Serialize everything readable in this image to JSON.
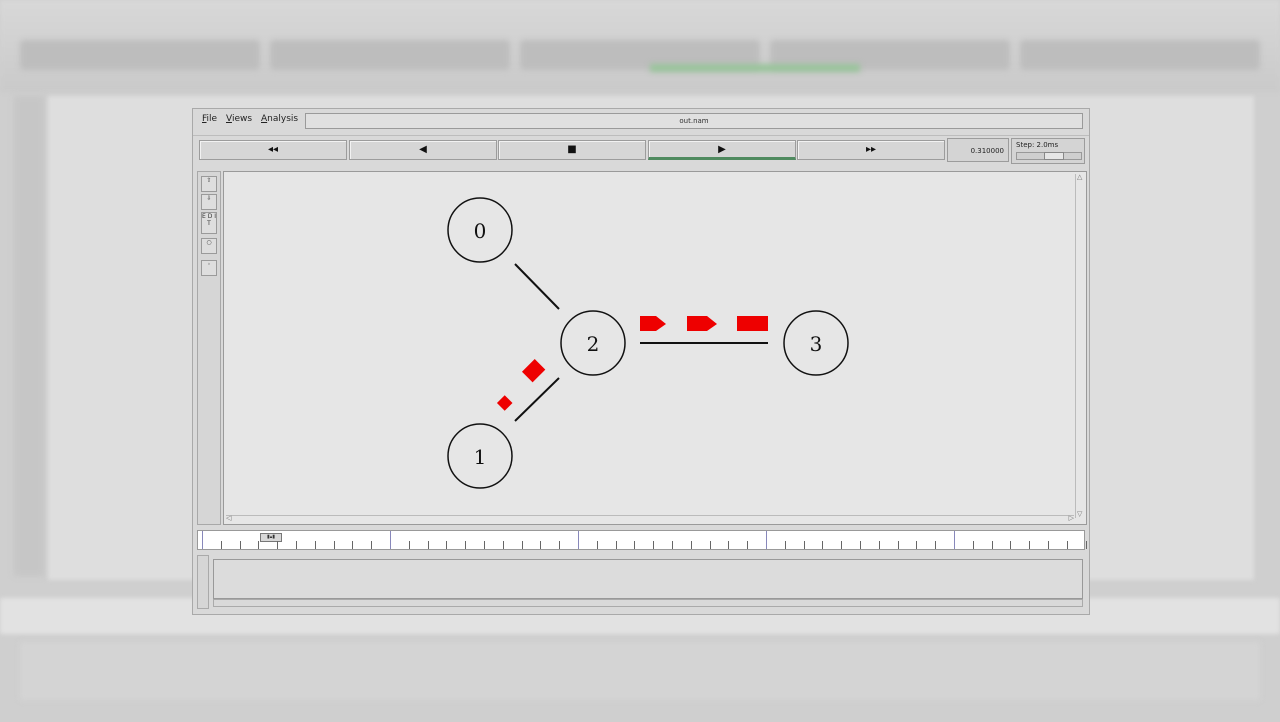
{
  "menu": {
    "file": "File",
    "views": "Views",
    "analysis": "Analysis",
    "file_accel": "F",
    "file_rest": "ile",
    "views_accel": "V",
    "views_rest": "iews",
    "analysis_accel": "A",
    "analysis_rest": "nalysis"
  },
  "window": {
    "title": "out.nam"
  },
  "toolbar": {
    "rewind": "◂◂",
    "back": "◀",
    "stop": "■",
    "play": "▶",
    "fast_forward": "▸▸",
    "active": "play"
  },
  "sim": {
    "time": "0.310000",
    "step_label": "Step: 2.0ms"
  },
  "tools": {
    "edit": "E D I T"
  },
  "network": {
    "nodes": [
      {
        "id": "0",
        "label": "0"
      },
      {
        "id": "1",
        "label": "1"
      },
      {
        "id": "2",
        "label": "2"
      },
      {
        "id": "3",
        "label": "3"
      }
    ],
    "links": [
      {
        "from": "0",
        "to": "2"
      },
      {
        "from": "1",
        "to": "2"
      },
      {
        "from": "2",
        "to": "3"
      }
    ],
    "packet_color": "#ee0000"
  }
}
